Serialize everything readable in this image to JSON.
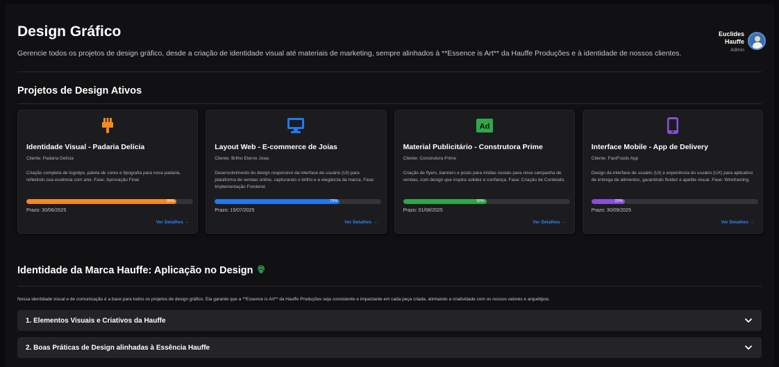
{
  "header": {
    "title": "Design Gráfico",
    "description": "Gerencie todos os projetos de design gráfico, desde a criação de identidade visual até materiais de marketing, sempre alinhados à **Essence is Art** da Hauffe Produções e à identidade de nossos clientes."
  },
  "user": {
    "name": "Euclides Hauffe",
    "role": "Admin"
  },
  "projects": {
    "section_title": "Projetos de Design Ativos",
    "cards": [
      {
        "icon": "paintbrush-icon",
        "accent": "#f58a1f",
        "title": "Identidade Visual - Padaria Delícia",
        "client": "Cliente: Padaria Delícia",
        "description": "Criação completa de logotipo, paleta de cores e tipografia para nova padaria, refletindo sua essência com arte. Fase: Aprovação Final.",
        "progress": 90,
        "progress_label": "90%",
        "deadline": "Prazo: 30/06/2025",
        "link": "Ver Detalhes →"
      },
      {
        "icon": "desktop-icon",
        "accent": "#1f7aef",
        "title": "Layout Web - E-commerce de Joias",
        "client": "Cliente: Brilho Eterno Joias",
        "description": "Desenvolvimento do design responsivo da interface de usuário (UI) para plataforma de vendas online, capturando o brilho e a elegância da marca. Fase: Implementação Frontend.",
        "progress": 75,
        "progress_label": "75%",
        "deadline": "Prazo: 15/07/2025",
        "link": "Ver Detalhes →"
      },
      {
        "icon": "ad-icon",
        "accent": "#2ea84a",
        "title": "Material Publicitário - Construtora Prime",
        "client": "Cliente: Construtora Prime",
        "description": "Criação de flyers, banners e posts para mídias sociais para nova campanha de vendas, com design que inspira solidez e confiança. Fase: Criação de Conteúdo.",
        "progress": 50,
        "progress_label": "50%",
        "deadline": "Prazo: 01/08/2025",
        "link": "Ver Detalhes →"
      },
      {
        "icon": "mobile-icon",
        "accent": "#8a4fd8",
        "title": "Interface Mobile - App de Delivery",
        "client": "Cliente: FastFoods App",
        "description": "Design da interface de usuário (UI) e experiência do usuário (UX) para aplicativo de entrega de alimentos, garantindo fluidez e apetite visual. Fase: Wireframing.",
        "progress": 20,
        "progress_label": "20%",
        "deadline": "Prazo: 30/09/2025",
        "link": "Ver Detalhes →"
      }
    ]
  },
  "brand": {
    "section_title": "Identidade da Marca Hauffe: Aplicação no Design",
    "description": "Nossa identidade visual e de comunicação é a base para todos os projetos de design gráfico. Ela garante que a **Essence is Art** da Hauffe Produções seja consistente e impactante em cada peça criada, alinhando a criatividade com os nossos valores e arquétipos.",
    "accordions": [
      {
        "label": "1. Elementos Visuais e Criativos da Hauffe"
      },
      {
        "label": "2. Boas Práticas de Design alinhadas à Essência Hauffe"
      }
    ]
  }
}
